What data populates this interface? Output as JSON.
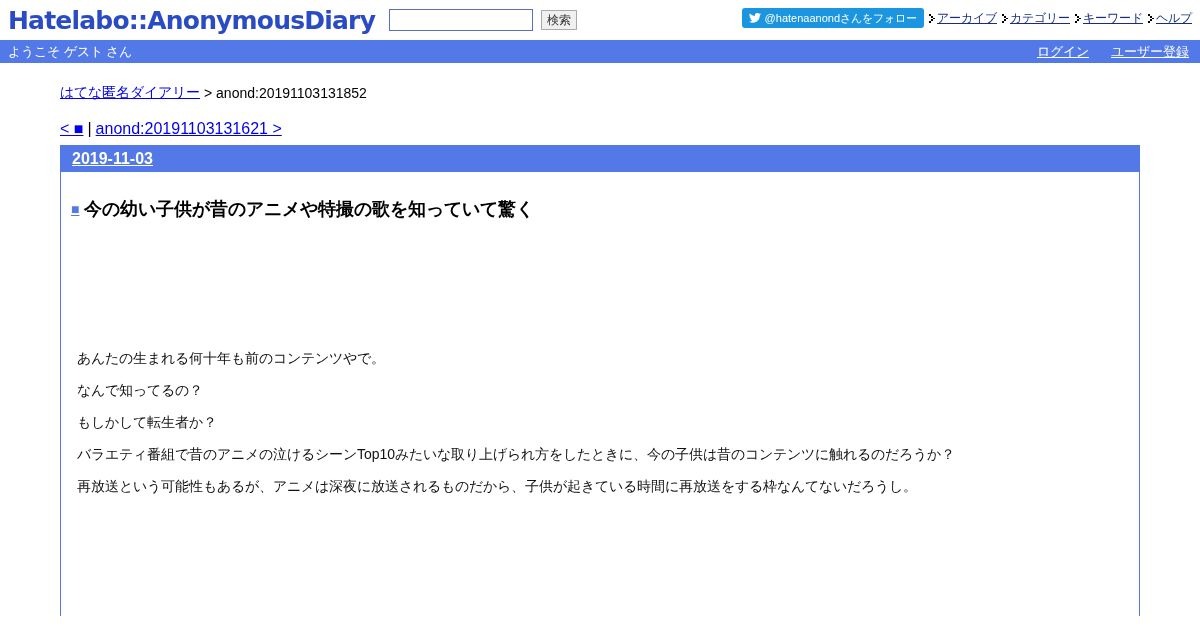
{
  "header": {
    "logo": "Hatelabo::AnonymousDiary",
    "search_button": "検索",
    "follow_button": "@hatenaanondさんをフォロー",
    "nav_links": [
      "アーカイブ",
      "カテゴリー",
      "キーワード",
      "ヘルプ"
    ]
  },
  "welcome_bar": {
    "greeting": "ようこそ ゲスト さん",
    "links": [
      "ログイン",
      "ユーザー登録"
    ]
  },
  "breadcrumb": {
    "link": "はてな匿名ダイアリー",
    "current": "> anond:20191103131852"
  },
  "pager": {
    "prev": "< ■",
    "separator": "|",
    "next": "anond:20191103131621 >"
  },
  "entry": {
    "date": "2019-11-03",
    "title_mark": "■",
    "title": "今の幼い子供が昔のアニメや特撮の歌を知っていて驚く",
    "paragraphs": [
      "あんたの生まれる何十年も前のコンテンツやで。",
      "なんで知ってるの？",
      "もしかして転生者か？",
      "バラエティ番組で昔のアニメの泣けるシーンTop10みたいな取り上げられ方をしたときに、今の子供は昔のコンテンツに触れるのだろうか？",
      "再放送という可能性もあるが、アニメは深夜に放送されるものだから、子供が起きている時間に再放送をする枠なんてないだろうし。"
    ]
  }
}
